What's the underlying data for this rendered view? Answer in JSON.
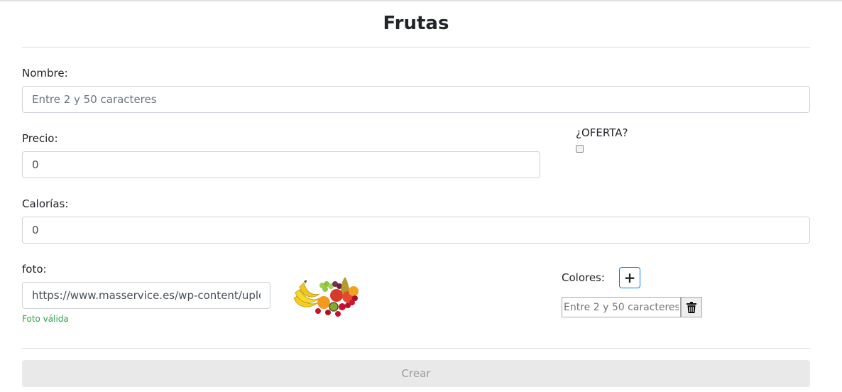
{
  "title": "Frutas",
  "form": {
    "nombre": {
      "label": "Nombre:",
      "value": "",
      "placeholder": "Entre 2 y 50 caracteres"
    },
    "precio": {
      "label": "Precio:",
      "value": "0"
    },
    "oferta": {
      "label": "¿OFERTA?",
      "checked": false
    },
    "calorias": {
      "label": "Calorías:",
      "value": "0"
    },
    "foto": {
      "label": "foto:",
      "value": "https://www.masservice.es/wp-content/uploads/",
      "feedback": "Foto válida"
    },
    "colores": {
      "label": "Colores:",
      "add_label": "+",
      "input_value": "",
      "input_placeholder": "Entre 2 y 50 caracteres"
    },
    "submit_label": "Crear"
  },
  "icons": {
    "add": "plus-icon",
    "delete": "trash-icon",
    "preview": "fruit-image"
  },
  "colors": {
    "valid": "#28a745",
    "accent": "#007bff",
    "disabled_bg": "#e9e9e9"
  }
}
